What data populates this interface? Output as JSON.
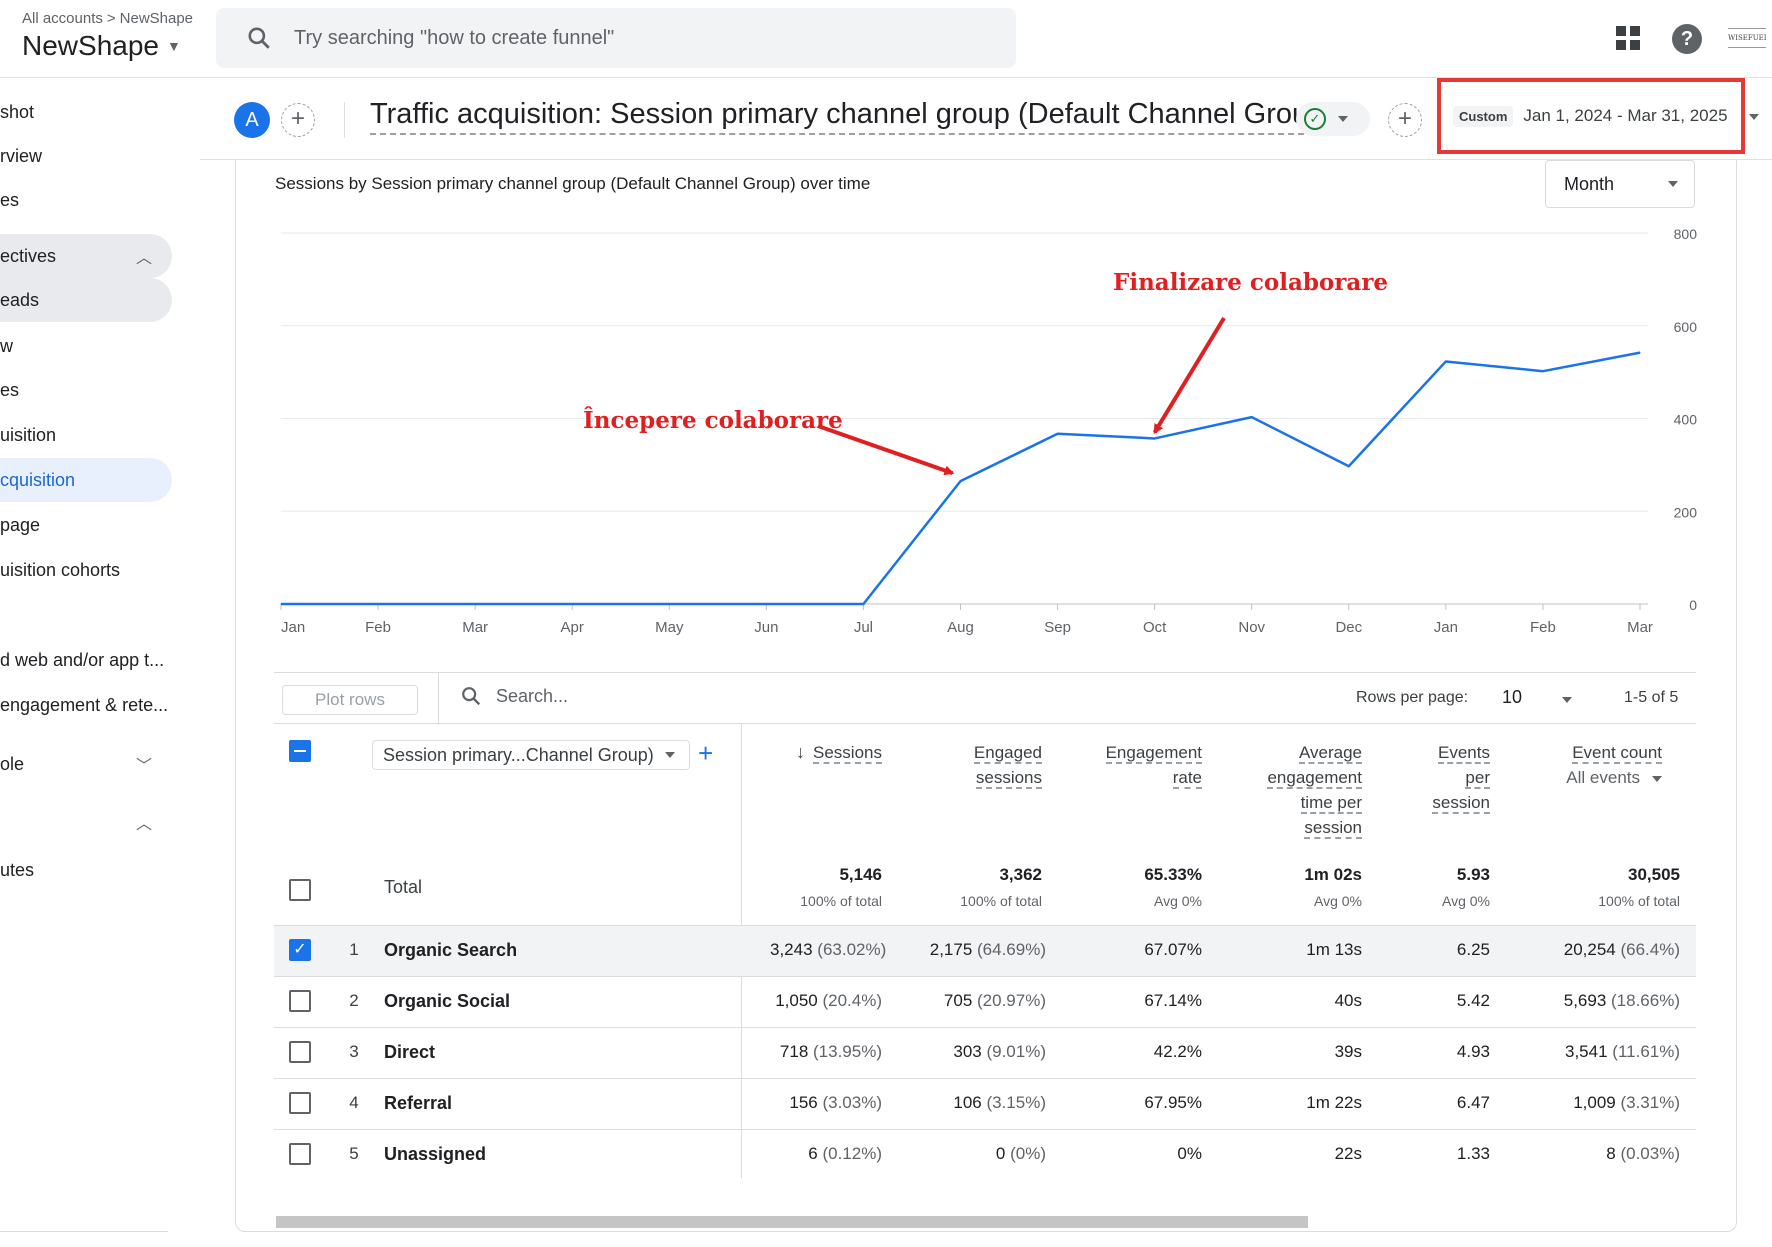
{
  "topbar": {
    "breadcrumb_root": "All accounts",
    "breadcrumb_sep": ">",
    "breadcrumb_account": "NewShape",
    "account_name": "NewShape",
    "search_placeholder": "Try searching \"how to create funnel\"",
    "logo_text": "WISEFUEL"
  },
  "sidebar": {
    "items": [
      {
        "label": "shot"
      },
      {
        "label": "rview"
      },
      {
        "label": "es"
      },
      {
        "label": "ectives",
        "chevron": "up"
      },
      {
        "label": "eads"
      },
      {
        "label": "w"
      },
      {
        "label": "es"
      },
      {
        "label": "uisition"
      },
      {
        "label": "cquisition"
      },
      {
        "label": "page"
      },
      {
        "label": "uisition cohorts"
      },
      {
        "label": "d web and/or app t..."
      },
      {
        "label": "engagement & rete..."
      },
      {
        "label": "ole",
        "chevron": "down"
      },
      {
        "label": "",
        "chevron": "up"
      },
      {
        "label": "utes"
      }
    ]
  },
  "header": {
    "avatar_letter": "A",
    "report_title": "Traffic acquisition: Session primary channel group (Default Channel Group)",
    "date_chip": "Custom",
    "date_range": "Jan 1, 2024 - Mar 31, 2025"
  },
  "chart_data": {
    "type": "line",
    "title": "Sessions by Session primary channel group (Default Channel Group) over time",
    "categories": [
      "Jan",
      "Feb",
      "Mar",
      "Apr",
      "May",
      "Jun",
      "Jul",
      "Aug",
      "Sep",
      "Oct",
      "Nov",
      "Dec",
      "Jan",
      "Feb",
      "Mar"
    ],
    "series": [
      {
        "values": [
          0,
          0,
          0,
          0,
          0,
          0,
          0,
          265,
          367,
          357,
          403,
          297,
          523,
          502,
          542
        ]
      }
    ],
    "ylim": [
      0,
      800
    ],
    "yticks": [
      "0",
      "200",
      "400",
      "600",
      "800"
    ],
    "grid": true,
    "granularity": "Month",
    "line_color": "#1a73e8",
    "annotations": [
      {
        "text": "Începere colaborare",
        "points_to": "Aug",
        "color": "#e02020"
      },
      {
        "text": "Finalizare colaborare",
        "points_to": "Oct",
        "color": "#e02020"
      }
    ]
  },
  "table": {
    "plot_rows_label": "Plot rows",
    "search_placeholder": "Search...",
    "rows_per_page_label": "Rows per page:",
    "rows_per_page": "10",
    "pager": "1-5 of 5",
    "dimension_label": "Session primary...Channel Group)",
    "columns": {
      "sessions": "Sessions",
      "engaged_1": "Engaged",
      "engaged_2": "sessions",
      "rate_1": "Engagement",
      "rate_2": "rate",
      "avg_1": "Average",
      "avg_2": "engagement",
      "avg_3": "time per",
      "avg_4": "session",
      "eps_1": "Events",
      "eps_2": "per",
      "eps_3": "session",
      "ec_1": "Event count",
      "ec_2": "All events"
    },
    "total": {
      "label": "Total",
      "sessions": "5,146",
      "sessions_sub": "100% of total",
      "engaged": "3,362",
      "engaged_sub": "100% of total",
      "rate": "65.33%",
      "rate_sub": "Avg 0%",
      "avg_time": "1m 02s",
      "avg_time_sub": "Avg 0%",
      "eps": "5.93",
      "eps_sub": "Avg 0%",
      "events": "30,505",
      "events_sub": "100% of total"
    },
    "rows": [
      {
        "num": "1",
        "name": "Organic Search",
        "sessions": "3,243",
        "sessions_pct": "(63.02%)",
        "engaged": "2,175",
        "engaged_pct": "(64.69%)",
        "rate": "67.07%",
        "avg_time": "1m 13s",
        "eps": "6.25",
        "events": "20,254",
        "events_pct": "(66.4%)",
        "checked": true
      },
      {
        "num": "2",
        "name": "Organic Social",
        "sessions": "1,050",
        "sessions_pct": "(20.4%)",
        "engaged": "705",
        "engaged_pct": "(20.97%)",
        "rate": "67.14%",
        "avg_time": "40s",
        "eps": "5.42",
        "events": "5,693",
        "events_pct": "(18.66%)",
        "checked": false
      },
      {
        "num": "3",
        "name": "Direct",
        "sessions": "718",
        "sessions_pct": "(13.95%)",
        "engaged": "303",
        "engaged_pct": "(9.01%)",
        "rate": "42.2%",
        "avg_time": "39s",
        "eps": "4.93",
        "events": "3,541",
        "events_pct": "(11.61%)",
        "checked": false
      },
      {
        "num": "4",
        "name": "Referral",
        "sessions": "156",
        "sessions_pct": "(3.03%)",
        "engaged": "106",
        "engaged_pct": "(3.15%)",
        "rate": "67.95%",
        "avg_time": "1m 22s",
        "eps": "6.47",
        "events": "1,009",
        "events_pct": "(3.31%)",
        "checked": false
      },
      {
        "num": "5",
        "name": "Unassigned",
        "sessions": "6",
        "sessions_pct": "(0.12%)",
        "engaged": "0",
        "engaged_pct": "(0%)",
        "rate": "0%",
        "avg_time": "22s",
        "eps": "1.33",
        "events": "8",
        "events_pct": "(0.03%)",
        "checked": false
      }
    ]
  }
}
